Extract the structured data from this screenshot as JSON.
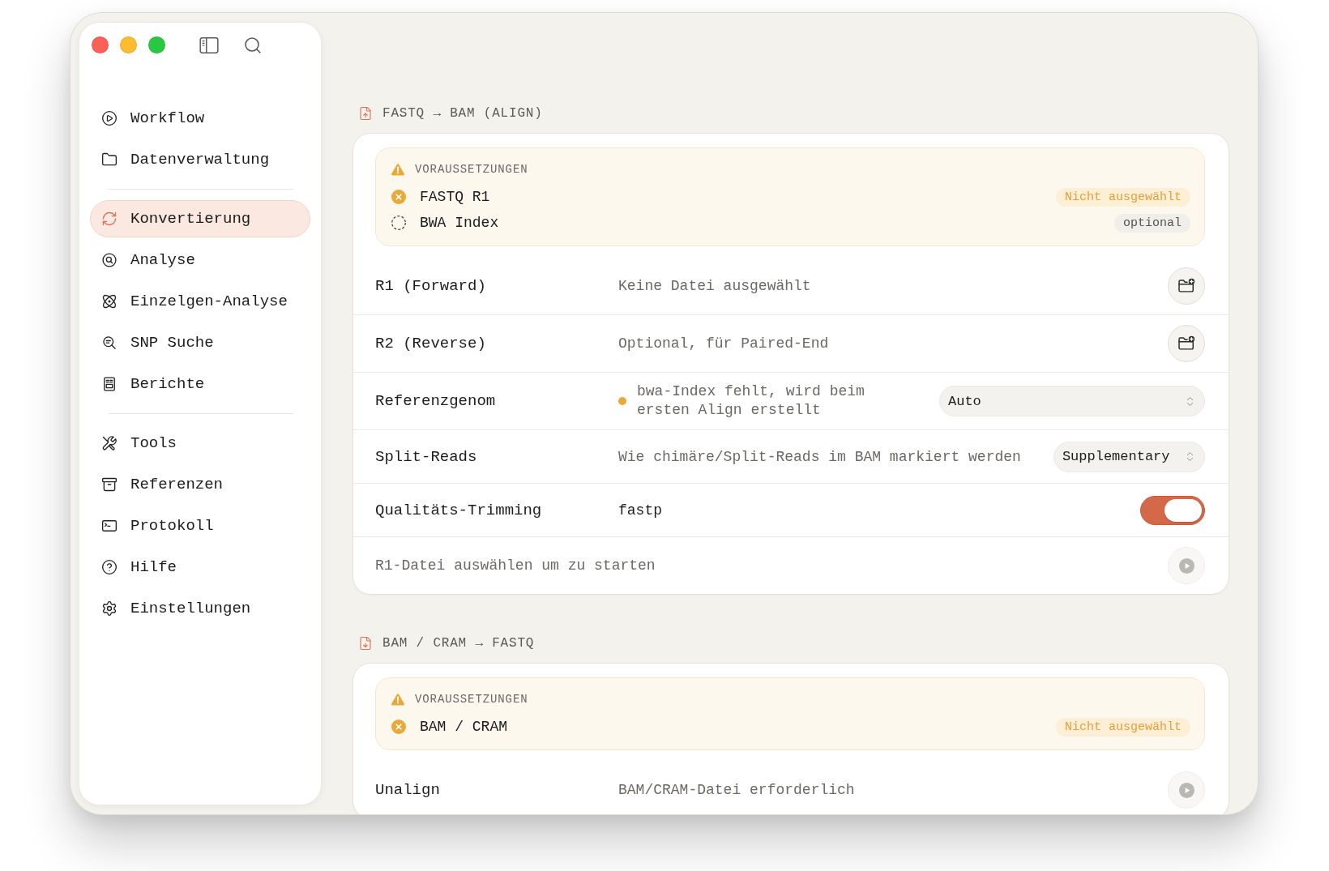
{
  "sidebar": {
    "groups": [
      {
        "items": [
          {
            "label": "Workflow",
            "selected": false
          },
          {
            "label": "Datenverwaltung",
            "selected": false
          }
        ]
      },
      {
        "items": [
          {
            "label": "Konvertierung",
            "selected": true
          },
          {
            "label": "Analyse",
            "selected": false
          },
          {
            "label": "Einzelgen-Analyse",
            "selected": false
          },
          {
            "label": "SNP Suche",
            "selected": false
          },
          {
            "label": "Berichte",
            "selected": false
          }
        ]
      },
      {
        "items": [
          {
            "label": "Tools",
            "selected": false
          },
          {
            "label": "Referenzen",
            "selected": false
          },
          {
            "label": "Protokoll",
            "selected": false
          },
          {
            "label": "Hilfe",
            "selected": false
          },
          {
            "label": "Einstellungen",
            "selected": false
          }
        ]
      }
    ]
  },
  "sections": [
    {
      "title": "FASTQ → BAM (ALIGN)",
      "prerequisites": {
        "heading": "VORAUSSETZUNGEN",
        "items": [
          {
            "label": "FASTQ R1",
            "optional": false,
            "badge": "Nicht ausgewählt"
          },
          {
            "label": "BWA Index",
            "optional": true,
            "badge": "optional"
          }
        ]
      },
      "rows": [
        {
          "kind": "file",
          "label": "R1 (Forward)",
          "file_status": "Keine Datei ausgewählt"
        },
        {
          "kind": "file",
          "label": "R2 (Reverse)",
          "file_status": "Optional, für Paired-End"
        },
        {
          "kind": "select",
          "label": "Referenzgenom",
          "note": "bwa-Index fehlt, wird beim ersten Align erstellt",
          "warning": true,
          "value": "Auto"
        },
        {
          "kind": "select",
          "label": "Split-Reads",
          "description": "Wie chimäre/Split-Reads im BAM markiert werden",
          "value": "Supplementary"
        },
        {
          "kind": "toggle",
          "label": "Qualitäts-Trimming",
          "value": "fastp",
          "on": true
        },
        {
          "kind": "action",
          "hint": "R1-Datei auswählen um zu starten",
          "disabled": true
        }
      ]
    },
    {
      "title": "BAM / CRAM → FASTQ",
      "prerequisites": {
        "heading": "VORAUSSETZUNGEN",
        "items": [
          {
            "label": "BAM / CRAM",
            "optional": false,
            "badge": "Nicht ausgewählt"
          }
        ]
      },
      "rows": [
        {
          "kind": "action",
          "label": "Unalign",
          "hint": "BAM/CRAM-Datei erforderlich",
          "disabled": true
        }
      ]
    }
  ]
}
